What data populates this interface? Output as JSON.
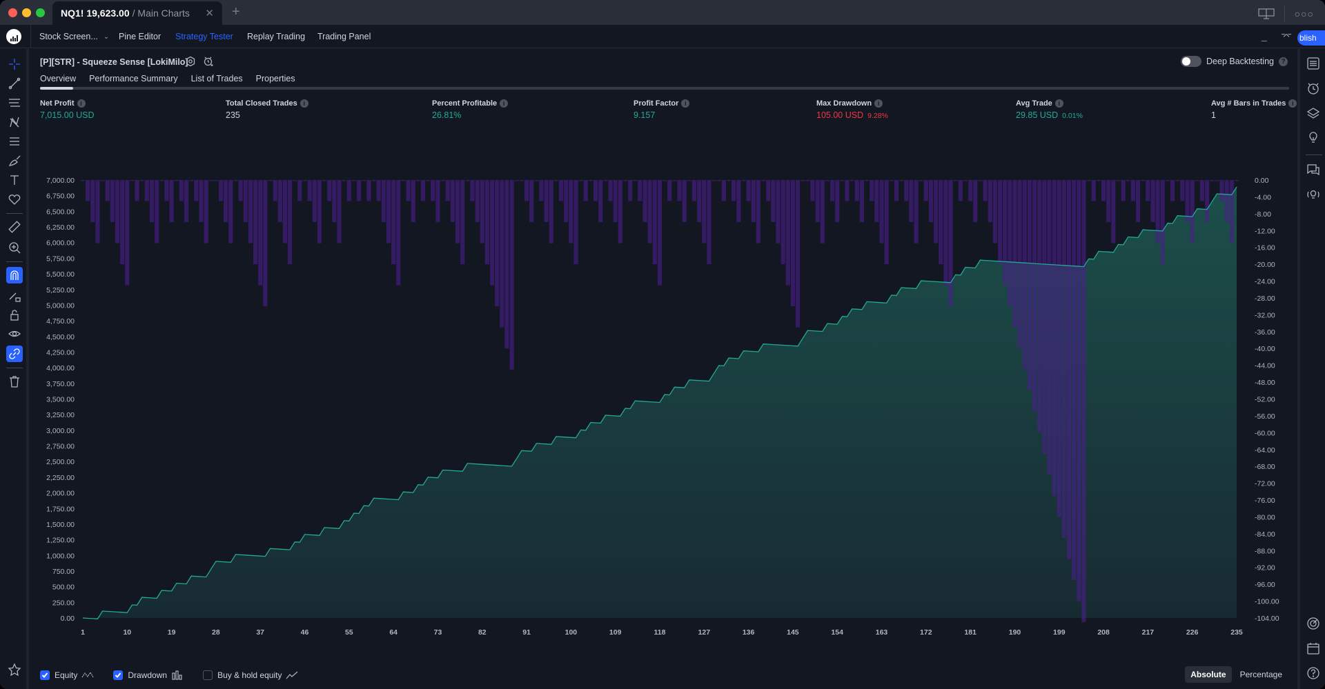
{
  "window": {
    "tab_symbol": "NQ1! 19,623.00",
    "tab_subtitle": "/ Main Charts",
    "close_icon": "close-icon",
    "new_tab_icon": "plus-icon"
  },
  "toolbar": {
    "menus": [
      "Stock Screen...",
      "Pine Editor",
      "Strategy Tester",
      "Replay Trading",
      "Trading Panel"
    ],
    "active_menu": "Strategy Tester",
    "publish_label": "blish"
  },
  "strategy": {
    "title": "[P][STR] - Squeeze Sense [LokiMilo]",
    "deep_backtesting_label": "Deep Backtesting",
    "deep_backtesting_enabled": false,
    "tabs": [
      "Overview",
      "Performance Summary",
      "List of Trades",
      "Properties"
    ],
    "active_tab": "Overview"
  },
  "metrics": [
    {
      "label": "Net Profit",
      "value": "7,015.00 USD",
      "pct": "",
      "color": "green"
    },
    {
      "label": "Total Closed Trades",
      "value": "235",
      "pct": "",
      "color": "white"
    },
    {
      "label": "Percent Profitable",
      "value": "26.81%",
      "pct": "",
      "color": "green"
    },
    {
      "label": "Profit Factor",
      "value": "9.157",
      "pct": "",
      "color": "green"
    },
    {
      "label": "Max Drawdown",
      "value": "105.00 USD",
      "pct": "9.28%",
      "color": "red"
    },
    {
      "label": "Avg Trade",
      "value": "29.85 USD",
      "pct": "0.01%",
      "color": "green"
    },
    {
      "label": "Avg # Bars in Trades",
      "value": "1",
      "pct": "",
      "color": "white"
    }
  ],
  "legend": {
    "equity_label": "Equity",
    "equity_checked": true,
    "drawdown_label": "Drawdown",
    "drawdown_checked": true,
    "buyhold_label": "Buy & hold equity",
    "buyhold_checked": false
  },
  "scale_modes": [
    "Absolute",
    "Percentage"
  ],
  "active_scale_mode": "Absolute",
  "chart_data": {
    "type": "area",
    "title": "",
    "series": [
      {
        "name": "Equity",
        "type": "area",
        "color": "#22ab94",
        "axis": "left"
      },
      {
        "name": "Drawdown",
        "type": "bar",
        "color": "#3a1b63",
        "axis": "right"
      }
    ],
    "trades_total": 235,
    "win_amount": 125,
    "loss_amount": -5,
    "loss_streaks_before_each_win": [
      0,
      3,
      5,
      1,
      3,
      2,
      2,
      3,
      0,
      3,
      6,
      4,
      1,
      3,
      3,
      1,
      1,
      1,
      5,
      2,
      1,
      2,
      4,
      9,
      0,
      2,
      3,
      4,
      1,
      2,
      3,
      1,
      5,
      1,
      2,
      4,
      0,
      1,
      2,
      3,
      7,
      0,
      3,
      2,
      1,
      2,
      4,
      1,
      3,
      6,
      1,
      2,
      21,
      1,
      3,
      1,
      2,
      4,
      1,
      3,
      2,
      0,
      3
    ],
    "x_ticks": [
      1,
      10,
      19,
      28,
      37,
      46,
      55,
      64,
      73,
      82,
      91,
      100,
      109,
      118,
      127,
      136,
      145,
      154,
      163,
      172,
      181,
      190,
      199,
      208,
      217,
      226,
      235
    ],
    "y_left_ticks": [
      "7,000.00",
      "6,750.00",
      "6,500.00",
      "6,250.00",
      "6,000.00",
      "5,750.00",
      "5,500.00",
      "5,250.00",
      "5,000.00",
      "4,750.00",
      "4,500.00",
      "4,250.00",
      "4,000.00",
      "3,750.00",
      "3,500.00",
      "3,250.00",
      "3,000.00",
      "2,750.00",
      "2,500.00",
      "2,250.00",
      "2,000.00",
      "1,750.00",
      "1,500.00",
      "1,250.00",
      "1,000.00",
      "750.00",
      "500.00",
      "250.00",
      "0.00"
    ],
    "y_right_ticks": [
      "0.00",
      "-4.00",
      "-8.00",
      "-12.00",
      "-16.00",
      "-20.00",
      "-24.00",
      "-28.00",
      "-32.00",
      "-36.00",
      "-40.00",
      "-44.00",
      "-48.00",
      "-52.00",
      "-56.00",
      "-60.00",
      "-64.00",
      "-68.00",
      "-72.00",
      "-76.00",
      "-80.00",
      "-84.00",
      "-88.00",
      "-92.00",
      "-96.00",
      "-100.00",
      "-104.00"
    ],
    "ylim_left": [
      0,
      7000
    ],
    "ylim_right": [
      -104,
      0
    ],
    "xlim": [
      1,
      235
    ],
    "grid": false
  }
}
